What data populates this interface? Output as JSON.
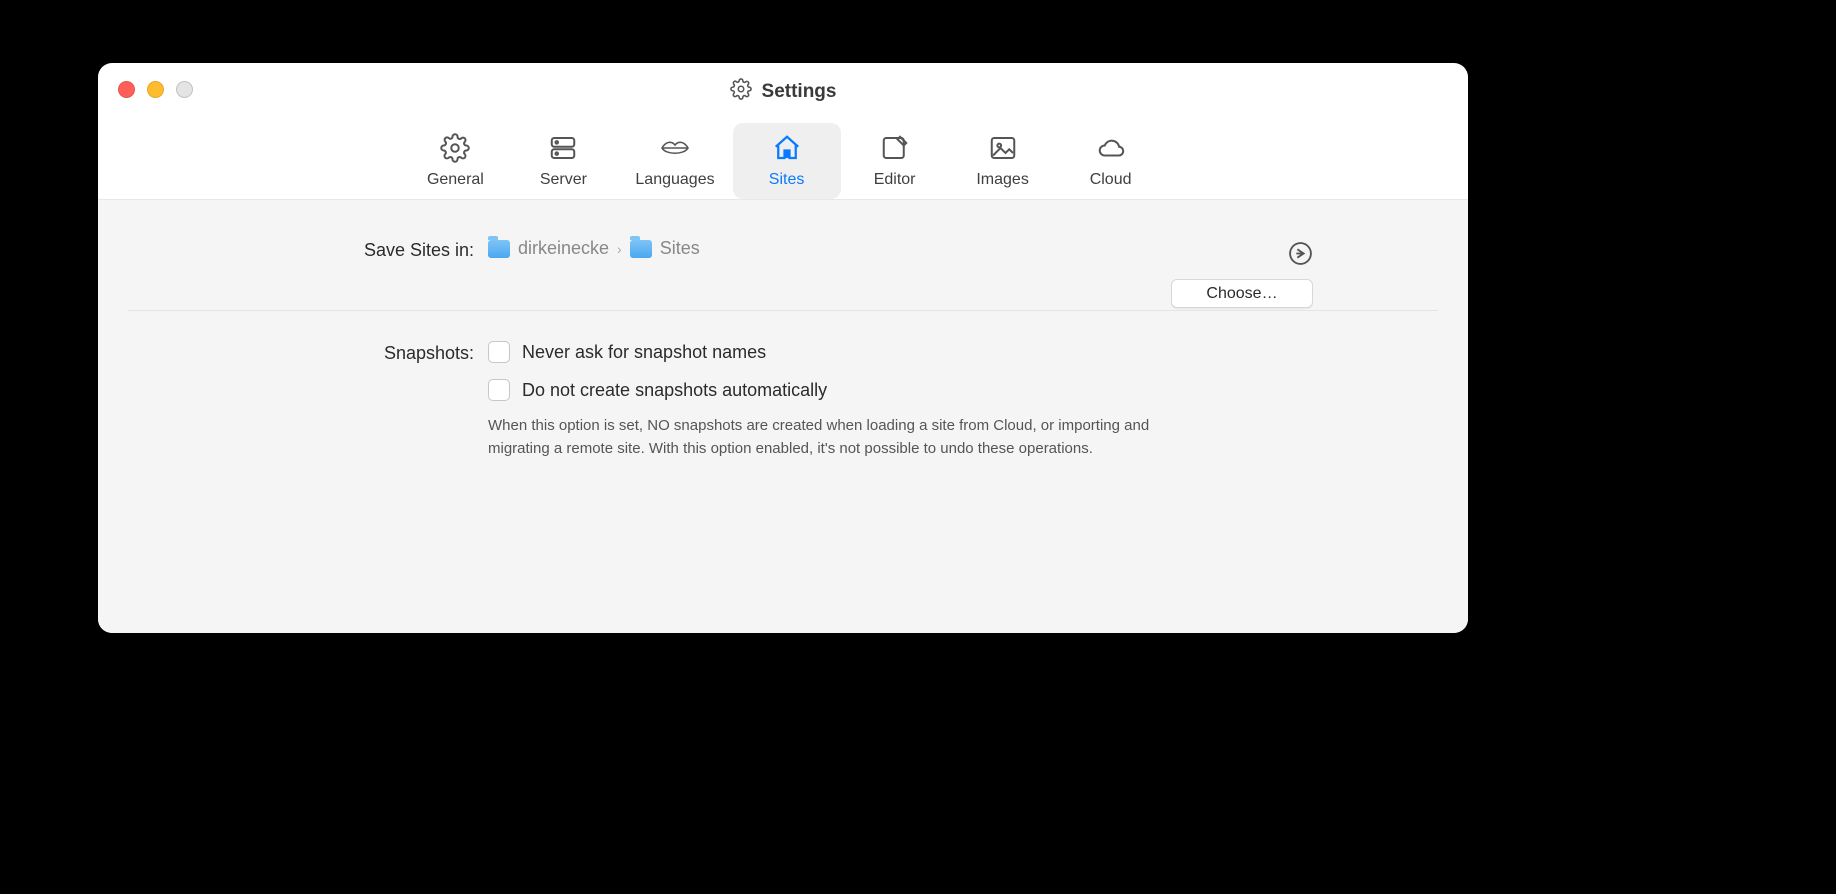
{
  "window": {
    "title": "Settings"
  },
  "tabs": {
    "general": "General",
    "server": "Server",
    "languages": "Languages",
    "sites": "Sites",
    "editor": "Editor",
    "images": "Images",
    "cloud": "Cloud"
  },
  "sites": {
    "save_label": "Save Sites in:",
    "path_parent": "dirkeinecke",
    "path_current": "Sites",
    "choose_button": "Choose…"
  },
  "snapshots": {
    "label": "Snapshots:",
    "never_ask": "Never ask for snapshot names",
    "no_auto": "Do not create snapshots automatically",
    "help": "When this option is set, NO snapshots are created when loading a site from Cloud, or importing and migrating a remote site. With this option enabled, it's not possible to undo these operations."
  }
}
